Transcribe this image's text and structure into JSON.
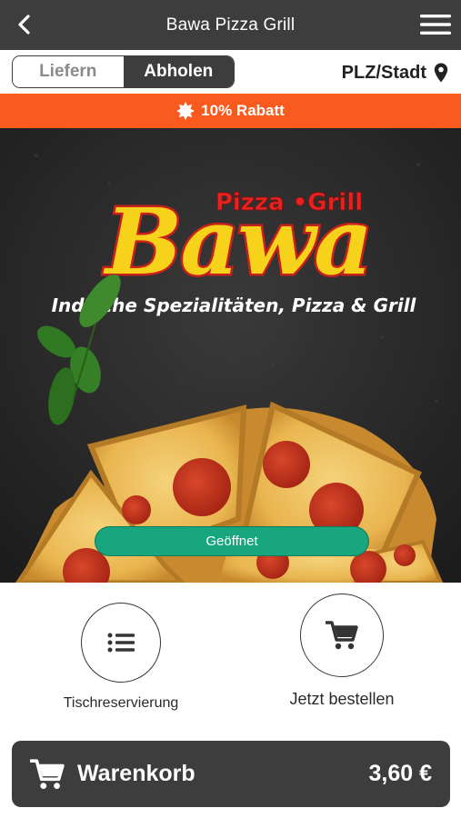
{
  "header": {
    "title": "Bawa Pizza Grill",
    "back_icon": "chevron-left-icon",
    "menu_icon": "hamburger-menu-icon"
  },
  "mode_toggle": {
    "options": [
      {
        "label": "Liefern",
        "active": false
      },
      {
        "label": "Abholen",
        "active": true
      }
    ]
  },
  "location": {
    "label": "PLZ/Stadt",
    "icon": "map-pin-icon"
  },
  "banner": {
    "text": "10% Rabatt",
    "icon": "badge-icon",
    "color": "#fb5a1e"
  },
  "hero": {
    "brand_name": "Bawa",
    "brand_tag": "Pizza •Grill",
    "slogan": "Indische Spezialitäten, Pizza & Grill",
    "status_label": "Geöffnet",
    "status_color": "#17a67d"
  },
  "actions": [
    {
      "label": "Tischreservierung",
      "icon": "list-icon"
    },
    {
      "label": "Jetzt bestellen",
      "icon": "cart-icon"
    }
  ],
  "cart": {
    "label": "Warenkorb",
    "total": "3,60 €",
    "icon": "cart-icon"
  },
  "colors": {
    "dark": "#3d3d3d",
    "accent": "#fb5a1e",
    "open": "#17a67d"
  }
}
